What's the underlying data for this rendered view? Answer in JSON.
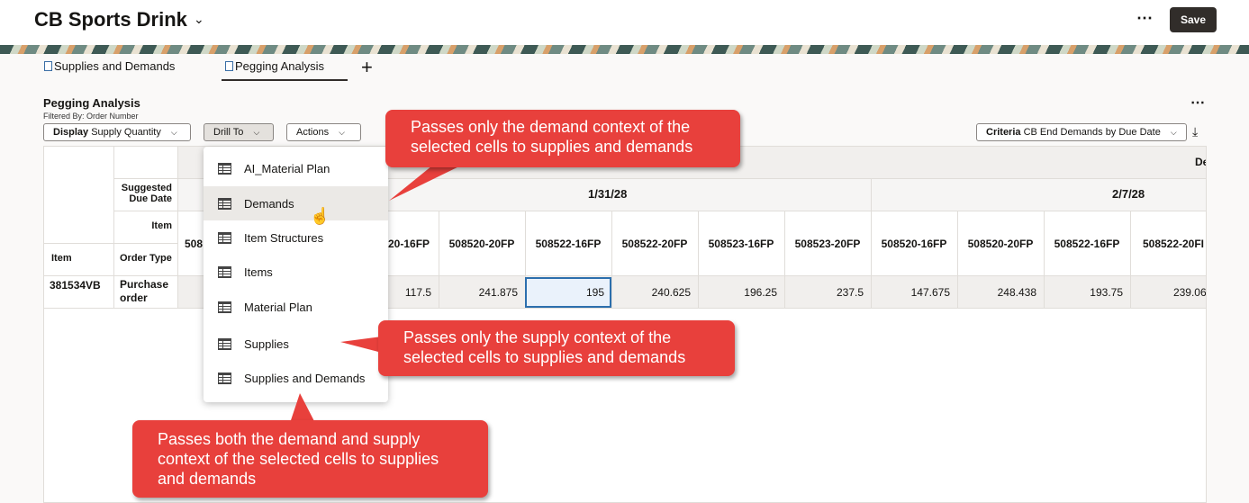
{
  "header": {
    "title": "CB Sports Drink",
    "save_label": "Save"
  },
  "tabs": [
    {
      "label": "Supplies and Demands"
    },
    {
      "label": "Pegging Analysis"
    }
  ],
  "panel": {
    "title": "Pegging Analysis",
    "filter": "Filtered By: Order Number",
    "display_label": "Display",
    "display_value": "Supply Quantity",
    "drill_label": "Drill To",
    "actions_label": "Actions",
    "criteria_label": "Criteria",
    "criteria_value": "CB End Demands by Due Date"
  },
  "grid": {
    "row_headers": {
      "suggested_due_date": "Suggested Due Date",
      "item": "Item",
      "item_col": "Item",
      "order_type": "Order Type"
    },
    "top_header_fragment": "De",
    "dates": [
      "1/31/28",
      "2/7/28"
    ],
    "partial_col_1": "508",
    "partial_col_2": "20-16FP",
    "columns": [
      "508520-20FP",
      "508522-16FP",
      "508522-20FP",
      "508523-16FP",
      "508523-20FP",
      "508520-16FP",
      "508520-20FP",
      "508522-16FP",
      "508522-20FI"
    ],
    "row": {
      "item": "381534VB",
      "order_type": "Purchase order",
      "partial_value": "117.5",
      "values": [
        "241.875",
        "195",
        "240.625",
        "196.25",
        "237.5",
        "147.675",
        "248.438",
        "193.75",
        "239.06:"
      ]
    }
  },
  "drill_menu": [
    "AI_Material Plan",
    "Demands",
    "Item Structures",
    "Items",
    "Material Plan",
    "Supplies",
    "Supplies and Demands"
  ],
  "callouts": {
    "demand": "Passes only  the demand context of the selected cells to supplies and demands",
    "supply": "Passes only the supply context of the selected cells to supplies and demands",
    "both": "Passes both the demand and supply context of the selected cells to supplies and demands"
  },
  "icons": [
    "chevron-down-icon",
    "more-icon",
    "document-icon",
    "plus-icon",
    "download-icon",
    "grid-icon",
    "hand-pointer-icon"
  ],
  "colors": {
    "callout": "#e8403c",
    "selection": "#2c6fad",
    "save_button": "#312d2a"
  }
}
